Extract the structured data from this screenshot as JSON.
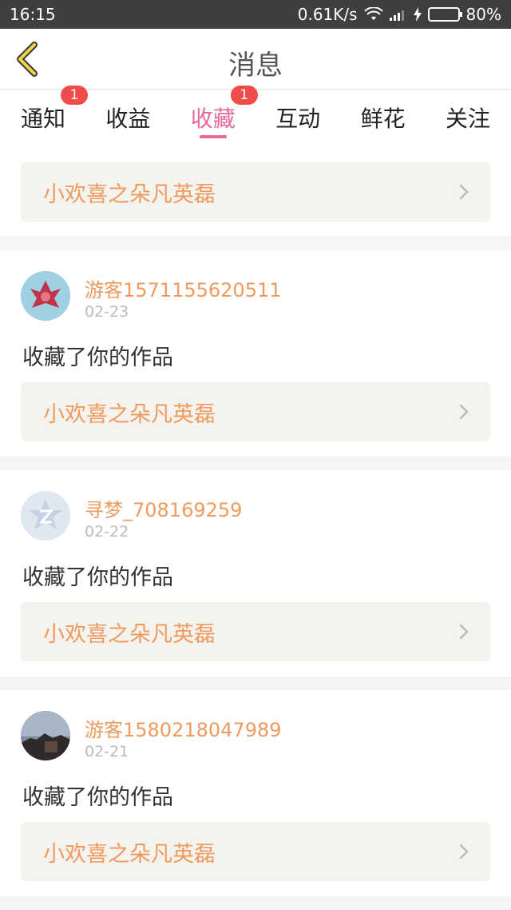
{
  "status_bar": {
    "time": "16:15",
    "speed": "0.61K/s",
    "battery": "80%"
  },
  "header": {
    "title": "消息"
  },
  "tabs": [
    {
      "label": "通知",
      "badge": "1"
    },
    {
      "label": "收益",
      "badge": ""
    },
    {
      "label": "收藏",
      "badge": "1"
    },
    {
      "label": "互动",
      "badge": ""
    },
    {
      "label": "鲜花",
      "badge": ""
    },
    {
      "label": "关注",
      "badge": ""
    }
  ],
  "top_item": {
    "work": "小欢喜之朵凡英磊"
  },
  "items": [
    {
      "user": "游客1571155620511",
      "date": "02-23",
      "action": "收藏了你的作品",
      "work": "小欢喜之朵凡英磊"
    },
    {
      "user": "寻梦_708169259",
      "date": "02-22",
      "action": "收藏了你的作品",
      "work": "小欢喜之朵凡英磊"
    },
    {
      "user": "游客1580218047989",
      "date": "02-21",
      "action": "收藏了你的作品",
      "work": "小欢喜之朵凡英磊"
    }
  ],
  "colors": {
    "accent": "#e66b9a",
    "name": "#ef9a5e",
    "badge": "#f04c4c"
  }
}
